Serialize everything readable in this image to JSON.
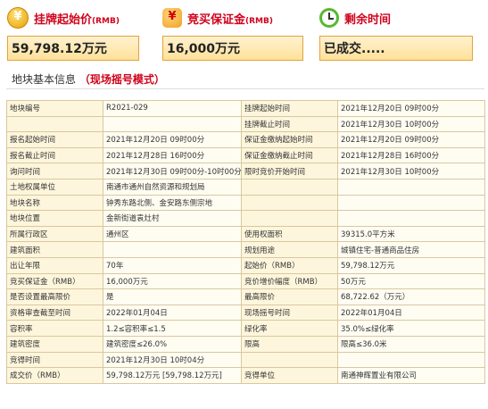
{
  "header": {
    "start_price_label": "挂牌起始价",
    "start_price_unit": "(RMB)",
    "start_price_value": "59,798.12万元",
    "deposit_label": "竞买保证金",
    "deposit_unit": "(RMB)",
    "deposit_value": "16,000万元",
    "time_left_label": "剩余时间",
    "time_left_value": "已成交....."
  },
  "section": {
    "title": "地块基本信息",
    "mode": "（现场摇号模式）"
  },
  "rows": [
    {
      "c1": "地块编号",
      "c2": "R2021-029",
      "c3": "挂牌起始时间",
      "c4": "2021年12月20日 09时00分"
    },
    {
      "c1": "",
      "c2": "",
      "c3": "挂牌截止时间",
      "c4": "2021年12月30日 10时00分"
    },
    {
      "c1": "报名起始时间",
      "c2": "2021年12月20日 09时00分",
      "c3": "保证金缴纳起始时间",
      "c4": "2021年12月20日 09时00分"
    },
    {
      "c1": "报名截止时间",
      "c2": "2021年12月28日 16时00分",
      "c3": "保证金缴纳截止时间",
      "c4": "2021年12月28日 16时00分"
    },
    {
      "c1": "询问时间",
      "c2": "2021年12月30日 09时00分-10时00分",
      "c3": "限时竞价开始时间",
      "c4": "2021年12月30日 10时00分"
    },
    {
      "c1": "土地权属单位",
      "c2": "南通市通州自然资源和规划局",
      "c3": "",
      "c4": ""
    },
    {
      "c1": "地块名称",
      "c2": "钟秀东路北侧、金安路东侧宗地",
      "c3": "",
      "c4": ""
    },
    {
      "c1": "地块位置",
      "c2": "金新街道袁灶村",
      "c3": "",
      "c4": ""
    },
    {
      "c1": "所属行政区",
      "c2": "通州区",
      "c3": "使用权面积",
      "c4": "39315.0平方米"
    },
    {
      "c1": "建筑面积",
      "c2": "",
      "c3": "规划用途",
      "c4": "城镇住宅-普通商品住房"
    },
    {
      "c1": "出让年限",
      "c2": "70年",
      "c3": "起始价（RMB）",
      "c4": "59,798.12万元"
    },
    {
      "c1": "竞买保证金（RMB）",
      "c2": "16,000万元",
      "c3": "竞价增价幅度（RMB）",
      "c4": "50万元"
    },
    {
      "c1": "是否设置最高限价",
      "c2": "是",
      "c3": "最高限价",
      "c4": "68,722.62（万元）"
    },
    {
      "c1": "资格审查截至时间",
      "c2": "2022年01月04日",
      "c3": "现场摇号时间",
      "c4": "2022年01月04日"
    },
    {
      "c1": "容积率",
      "c2": "1.2≤容积率≤1.5",
      "c3": "绿化率",
      "c4": "35.0%≤绿化率"
    },
    {
      "c1": "建筑密度",
      "c2": "建筑密度≤26.0%",
      "c3": "限高",
      "c4": "限高≤36.0米"
    },
    {
      "c1": "竞得时间",
      "c2": "2021年12月30日 10时04分",
      "c3": "",
      "c4": ""
    },
    {
      "c1": "成交价（RMB）",
      "c2": "59,798.12万元 [59,798.12万元]",
      "c3": "竞得单位",
      "c4": "南通神辉置业有限公司"
    }
  ]
}
